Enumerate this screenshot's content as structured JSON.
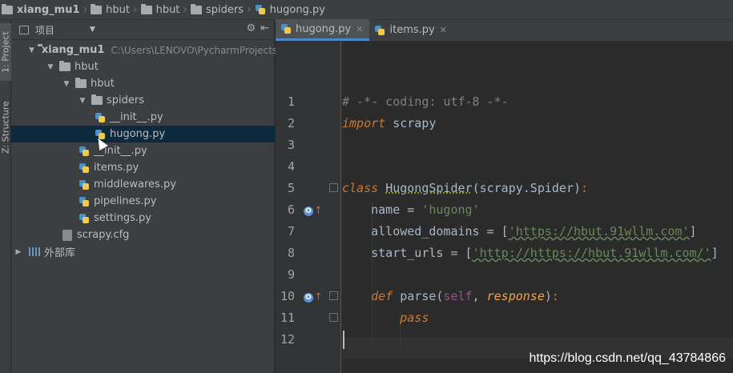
{
  "breadcrumb": [
    {
      "label": "xiang_mu1",
      "icon": "folder-icon",
      "bold": true
    },
    {
      "label": "hbut",
      "icon": "folder-icon"
    },
    {
      "label": "hbut",
      "icon": "folder-icon"
    },
    {
      "label": "spiders",
      "icon": "folder-icon"
    },
    {
      "label": "hugong.py",
      "icon": "python-file-icon"
    }
  ],
  "toolstrip": {
    "project_tab": "1: Project",
    "structure_tab": "Z: Structure"
  },
  "project_panel": {
    "title": "项目",
    "tools": [
      "gear-icon",
      "collapse-icon"
    ],
    "tree": [
      {
        "label": "xiang_mu1",
        "hint": "C:\\Users\\LENOVO\\PycharmProjects_l",
        "type": "folder",
        "expanded": true
      },
      {
        "label": "hbut",
        "type": "folder",
        "expanded": true
      },
      {
        "label": "hbut",
        "type": "folder",
        "expanded": true
      },
      {
        "label": "spiders",
        "type": "folder",
        "expanded": true
      },
      {
        "label": "__init__.py",
        "type": "python-file"
      },
      {
        "label": "hugong.py",
        "type": "python-file",
        "selected": true
      },
      {
        "label": "__init__.py",
        "type": "python-file"
      },
      {
        "label": "items.py",
        "type": "python-file"
      },
      {
        "label": "middlewares.py",
        "type": "python-file"
      },
      {
        "label": "pipelines.py",
        "type": "python-file"
      },
      {
        "label": "settings.py",
        "type": "python-file"
      },
      {
        "label": "scrapy.cfg",
        "type": "config-file"
      },
      {
        "label": "外部库",
        "type": "library",
        "expanded": false
      }
    ]
  },
  "editor": {
    "tabs": [
      {
        "label": "hugong.py",
        "active": true
      },
      {
        "label": "items.py",
        "active": false
      }
    ],
    "line_numbers": [
      "1",
      "2",
      "3",
      "4",
      "5",
      "6",
      "7",
      "8",
      "9",
      "10",
      "11",
      "12"
    ],
    "code": {
      "l1": "# -*- coding: utf-8 -*-",
      "l2_kw": "import",
      "l2_rest": " scrapy",
      "l5_kw": "class",
      "l5_name": "HugongSpider",
      "l5_rest": "(scrapy.Spider)",
      "l5_colon": ":",
      "l6_a": "name = ",
      "l6_str": "'hugong'",
      "l7_a": "allowed_domains = [",
      "l7_str": "'https://hbut.91wllm.com'",
      "l7_b": "]",
      "l8_a": "start_urls = [",
      "l8_str": "'http://https://hbut.91wllm.com/'",
      "l8_b": "]",
      "l10_kw": "def",
      "l10_name": " parse(",
      "l10_self": "self",
      "l10_comma": ", ",
      "l10_param": "response",
      "l10_close": ")",
      "l10_colon": ":",
      "l11_kw": "pass"
    }
  },
  "watermark": "https://blog.csdn.net/qq_43784866",
  "colors": {
    "keyword": "#cc7832",
    "string": "#6a8759",
    "comment": "#808080",
    "selection": "#0d293e",
    "accent": "#4a88c7"
  }
}
